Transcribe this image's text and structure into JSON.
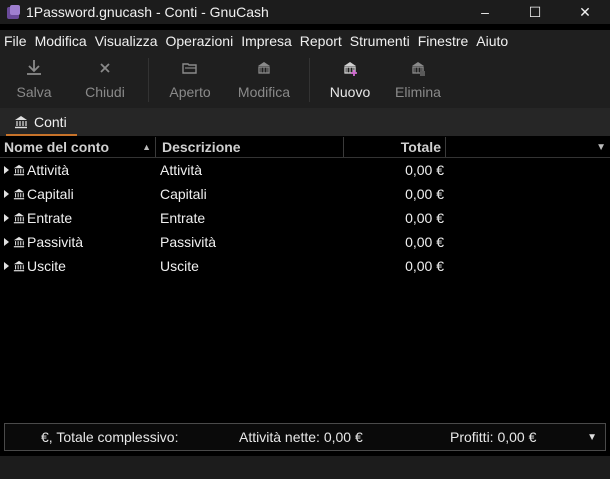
{
  "window": {
    "title": "1Password.gnucash - Conti - GnuCash",
    "minimize": "–",
    "maximize": "☐",
    "close": "✕"
  },
  "menu": [
    "File",
    "Modifica",
    "Visualizza",
    "Operazioni",
    "Impresa",
    "Report",
    "Strumenti",
    "Finestre",
    "Aiuto"
  ],
  "toolbar": {
    "save": "Salva",
    "close": "Chiudi",
    "open": "Aperto",
    "edit": "Modifica",
    "new": "Nuovo",
    "delete": "Elimina"
  },
  "tab": {
    "label": "Conti"
  },
  "columns": {
    "name": "Nome del conto",
    "description": "Descrizione",
    "total": "Totale"
  },
  "accounts": [
    {
      "name": "Attività",
      "description": "Attività",
      "total": "0,00 €"
    },
    {
      "name": "Capitali",
      "description": "Capitali",
      "total": "0,00 €"
    },
    {
      "name": "Entrate",
      "description": "Entrate",
      "total": "0,00 €"
    },
    {
      "name": "Passività",
      "description": "Passività",
      "total": "0,00 €"
    },
    {
      "name": "Uscite",
      "description": "Uscite",
      "total": "0,00 €"
    }
  ],
  "summary": {
    "currency_label": "€, Totale complessivo:",
    "net_assets": "Attività nette: 0,00 €",
    "profits": "Profitti: 0,00 €"
  }
}
